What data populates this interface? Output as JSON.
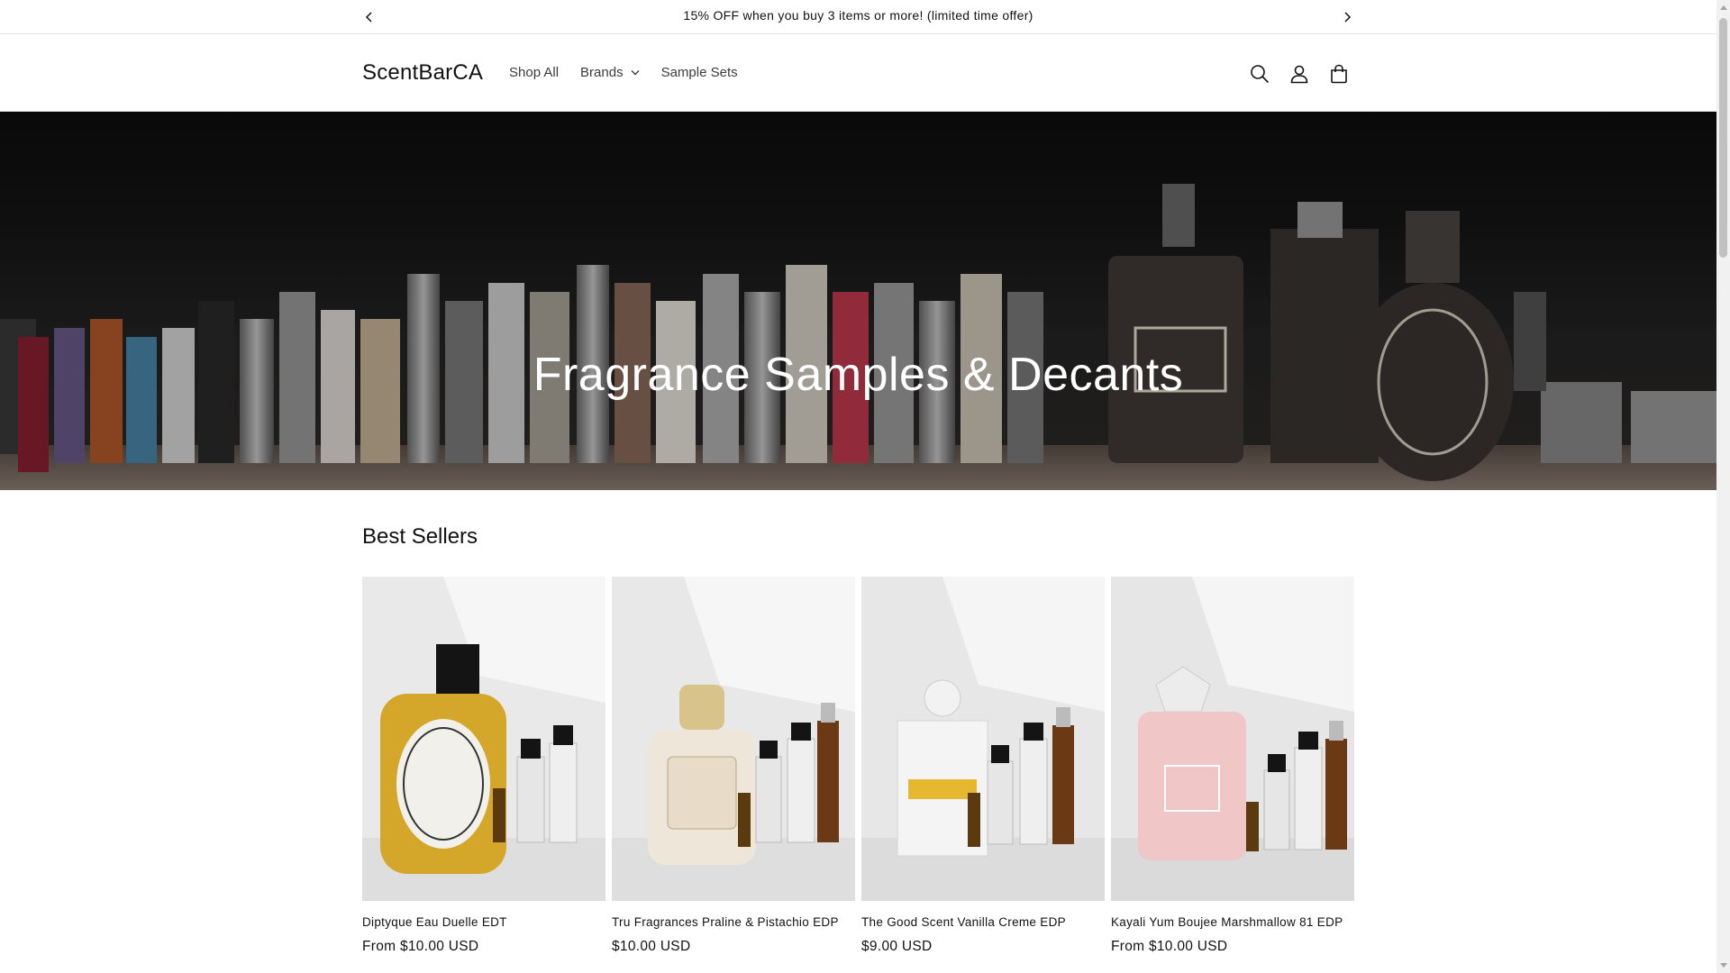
{
  "announcement": {
    "text": "15% OFF when you buy 3 items or more! (limited time offer)",
    "prev_icon": "chevron-left-icon",
    "next_icon": "chevron-right-icon"
  },
  "header": {
    "logo": "ScentBarCA",
    "nav": [
      {
        "label": "Shop All"
      },
      {
        "label": "Brands",
        "has_dropdown": true
      },
      {
        "label": "Sample Sets"
      }
    ],
    "icons": [
      "search-icon",
      "account-icon",
      "cart-icon"
    ]
  },
  "hero": {
    "title": "Fragrance Samples & Decants"
  },
  "best_sellers": {
    "title": "Best Sellers",
    "products": [
      {
        "name": "Diptyque Eau Duelle EDT",
        "price": "From $10.00 USD"
      },
      {
        "name": "Tru Fragrances Praline & Pistachio EDP",
        "price": "$10.00 USD"
      },
      {
        "name": "The Good Scent Vanilla Creme EDP",
        "price": "$9.00 USD"
      },
      {
        "name": "Kayali Yum Boujee Marshmallow 81 EDP",
        "price": "From $10.00 USD"
      }
    ]
  },
  "colors": {
    "text": "#121212",
    "border": "#e6e6e6",
    "hero_text": "#ffffff"
  }
}
